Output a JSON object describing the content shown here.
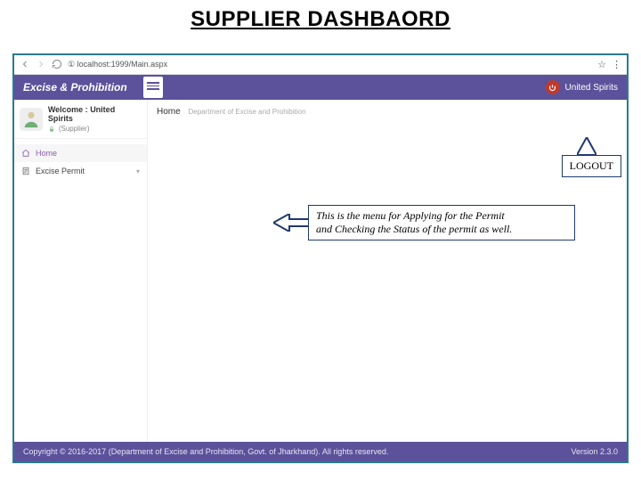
{
  "slide": {
    "title": "SUPPLIER DASHBAORD"
  },
  "browser": {
    "url": "① localhost:1999/Main.aspx"
  },
  "header": {
    "brand": "Excise & Prohibition",
    "user": "United Spirits"
  },
  "sidebar": {
    "welcome_prefix": "Welcome : ",
    "welcome_user": "United Spirits",
    "role": "(Supplier)",
    "items": [
      {
        "label": "Home",
        "active": true
      },
      {
        "label": "Excise Permit",
        "active": false
      }
    ]
  },
  "page": {
    "title": "Home",
    "breadcrumb": "Department of Excise and Prohibition"
  },
  "footer": {
    "copyright": "Copyright © 2016-2017 (Department of Excise and Prohibition, Govt. of Jharkhand). All rights reserved.",
    "version": "Version 2.3.0"
  },
  "callouts": {
    "logout": "LOGOUT",
    "menu_line1": "This is the menu for Applying for the Permit",
    "menu_line2": "and Checking the Status of the permit as well."
  }
}
